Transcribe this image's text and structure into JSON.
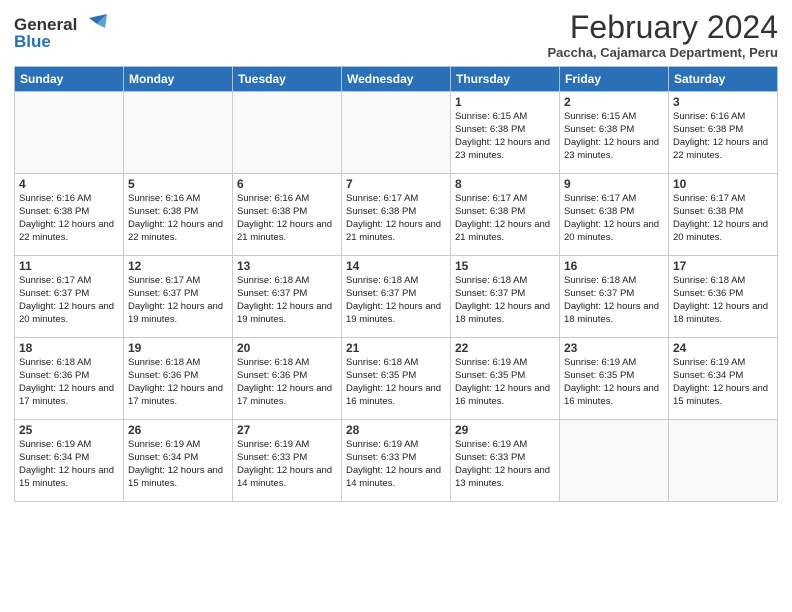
{
  "header": {
    "logo_line1": "General",
    "logo_line2": "Blue",
    "title": "February 2024",
    "subtitle": "Paccha, Cajamarca Department, Peru"
  },
  "days_of_week": [
    "Sunday",
    "Monday",
    "Tuesday",
    "Wednesday",
    "Thursday",
    "Friday",
    "Saturday"
  ],
  "weeks": [
    [
      {
        "day": "",
        "info": ""
      },
      {
        "day": "",
        "info": ""
      },
      {
        "day": "",
        "info": ""
      },
      {
        "day": "",
        "info": ""
      },
      {
        "day": "1",
        "info": "Sunrise: 6:15 AM\nSunset: 6:38 PM\nDaylight: 12 hours\nand 23 minutes."
      },
      {
        "day": "2",
        "info": "Sunrise: 6:15 AM\nSunset: 6:38 PM\nDaylight: 12 hours\nand 23 minutes."
      },
      {
        "day": "3",
        "info": "Sunrise: 6:16 AM\nSunset: 6:38 PM\nDaylight: 12 hours\nand 22 minutes."
      }
    ],
    [
      {
        "day": "4",
        "info": "Sunrise: 6:16 AM\nSunset: 6:38 PM\nDaylight: 12 hours\nand 22 minutes."
      },
      {
        "day": "5",
        "info": "Sunrise: 6:16 AM\nSunset: 6:38 PM\nDaylight: 12 hours\nand 22 minutes."
      },
      {
        "day": "6",
        "info": "Sunrise: 6:16 AM\nSunset: 6:38 PM\nDaylight: 12 hours\nand 21 minutes."
      },
      {
        "day": "7",
        "info": "Sunrise: 6:17 AM\nSunset: 6:38 PM\nDaylight: 12 hours\nand 21 minutes."
      },
      {
        "day": "8",
        "info": "Sunrise: 6:17 AM\nSunset: 6:38 PM\nDaylight: 12 hours\nand 21 minutes."
      },
      {
        "day": "9",
        "info": "Sunrise: 6:17 AM\nSunset: 6:38 PM\nDaylight: 12 hours\nand 20 minutes."
      },
      {
        "day": "10",
        "info": "Sunrise: 6:17 AM\nSunset: 6:38 PM\nDaylight: 12 hours\nand 20 minutes."
      }
    ],
    [
      {
        "day": "11",
        "info": "Sunrise: 6:17 AM\nSunset: 6:37 PM\nDaylight: 12 hours\nand 20 minutes."
      },
      {
        "day": "12",
        "info": "Sunrise: 6:17 AM\nSunset: 6:37 PM\nDaylight: 12 hours\nand 19 minutes."
      },
      {
        "day": "13",
        "info": "Sunrise: 6:18 AM\nSunset: 6:37 PM\nDaylight: 12 hours\nand 19 minutes."
      },
      {
        "day": "14",
        "info": "Sunrise: 6:18 AM\nSunset: 6:37 PM\nDaylight: 12 hours\nand 19 minutes."
      },
      {
        "day": "15",
        "info": "Sunrise: 6:18 AM\nSunset: 6:37 PM\nDaylight: 12 hours\nand 18 minutes."
      },
      {
        "day": "16",
        "info": "Sunrise: 6:18 AM\nSunset: 6:37 PM\nDaylight: 12 hours\nand 18 minutes."
      },
      {
        "day": "17",
        "info": "Sunrise: 6:18 AM\nSunset: 6:36 PM\nDaylight: 12 hours\nand 18 minutes."
      }
    ],
    [
      {
        "day": "18",
        "info": "Sunrise: 6:18 AM\nSunset: 6:36 PM\nDaylight: 12 hours\nand 17 minutes."
      },
      {
        "day": "19",
        "info": "Sunrise: 6:18 AM\nSunset: 6:36 PM\nDaylight: 12 hours\nand 17 minutes."
      },
      {
        "day": "20",
        "info": "Sunrise: 6:18 AM\nSunset: 6:36 PM\nDaylight: 12 hours\nand 17 minutes."
      },
      {
        "day": "21",
        "info": "Sunrise: 6:18 AM\nSunset: 6:35 PM\nDaylight: 12 hours\nand 16 minutes."
      },
      {
        "day": "22",
        "info": "Sunrise: 6:19 AM\nSunset: 6:35 PM\nDaylight: 12 hours\nand 16 minutes."
      },
      {
        "day": "23",
        "info": "Sunrise: 6:19 AM\nSunset: 6:35 PM\nDaylight: 12 hours\nand 16 minutes."
      },
      {
        "day": "24",
        "info": "Sunrise: 6:19 AM\nSunset: 6:34 PM\nDaylight: 12 hours\nand 15 minutes."
      }
    ],
    [
      {
        "day": "25",
        "info": "Sunrise: 6:19 AM\nSunset: 6:34 PM\nDaylight: 12 hours\nand 15 minutes."
      },
      {
        "day": "26",
        "info": "Sunrise: 6:19 AM\nSunset: 6:34 PM\nDaylight: 12 hours\nand 15 minutes."
      },
      {
        "day": "27",
        "info": "Sunrise: 6:19 AM\nSunset: 6:33 PM\nDaylight: 12 hours\nand 14 minutes."
      },
      {
        "day": "28",
        "info": "Sunrise: 6:19 AM\nSunset: 6:33 PM\nDaylight: 12 hours\nand 14 minutes."
      },
      {
        "day": "29",
        "info": "Sunrise: 6:19 AM\nSunset: 6:33 PM\nDaylight: 12 hours\nand 13 minutes."
      },
      {
        "day": "",
        "info": ""
      },
      {
        "day": "",
        "info": ""
      }
    ]
  ]
}
